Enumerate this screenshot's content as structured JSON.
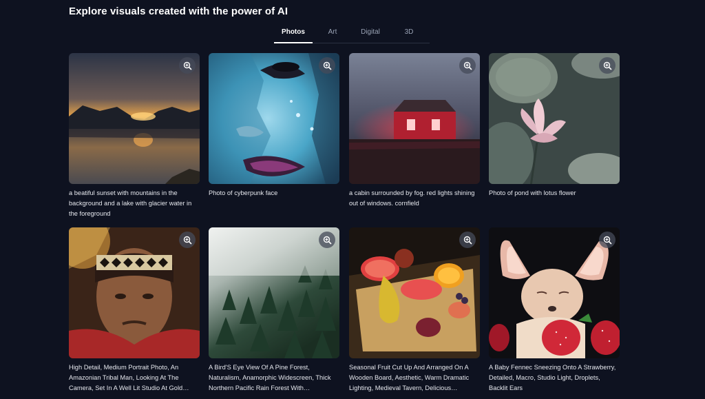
{
  "page": {
    "title": "Explore visuals created with the power of AI"
  },
  "tabs": [
    {
      "label": "Photos",
      "active": true
    },
    {
      "label": "Art",
      "active": false
    },
    {
      "label": "Digital",
      "active": false
    },
    {
      "label": "3D",
      "active": false
    }
  ],
  "gallery": {
    "zoom_icon": "zoom-in-icon",
    "items": [
      {
        "caption": "a beatiful sunset with mountains in the background and a lake with glacier water in the foreground"
      },
      {
        "caption": "Photo of cyberpunk face"
      },
      {
        "caption": "a cabin surrounded by fog. red lights shining out of windows. cornfield"
      },
      {
        "caption": "Photo of pond with lotus flower"
      },
      {
        "caption": "High Detail, Medium Portrait Photo, An Amazonian Tribal Man, Looking At The Camera, Set In A Well Lit Studio At Gold…"
      },
      {
        "caption": "A Bird'S Eye View Of A Pine Forest, Naturalism, Anamorphic Widescreen, Thick Northern Pacific Rain Forest With…"
      },
      {
        "caption": "Seasonal Fruit Cut Up And Arranged On A Wooden Board, Aesthetic, Warm Dramatic Lighting, Medieval Tavern, Delicious…"
      },
      {
        "caption": "A Baby Fennec Sneezing Onto A Strawberry, Detailed, Macro, Studio Light, Droplets, Backlit Ears"
      }
    ]
  },
  "colors": {
    "background": "#0e1220",
    "tab_active": "#ffffff",
    "tab_inactive": "#9aa3b5"
  }
}
